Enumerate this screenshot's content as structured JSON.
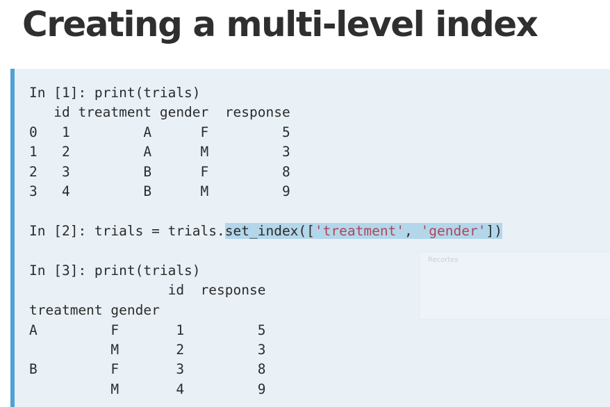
{
  "slide": {
    "title": "Creating a multi-level index"
  },
  "code": {
    "in1_prompt": "In [1]: print(trials)",
    "df1_header": "   id treatment gender  response",
    "df1_rows": [
      "0   1         A      F         5",
      "1   2         A      M         3",
      "2   3         B      F         8",
      "3   4         B      M         9"
    ],
    "in2_prefix": "In [2]: trials = trials.",
    "in2_call_start": "set_index([",
    "in2_str1": "'treatment'",
    "in2_sep": ", ",
    "in2_str2": "'gender'",
    "in2_call_end": "])",
    "in3_prompt": "In [3]: print(trials)",
    "df2_header_cols": "                 id  response",
    "df2_header_index": "treatment gender",
    "df2_rows": [
      "A         F       1         5",
      "          M       2         3",
      "B         F       3         8",
      "          M       4         9"
    ]
  },
  "overlay": {
    "label": "Recortes"
  },
  "colors": {
    "panel_bg": "#e9f1f7",
    "accent_bar": "#4fa1d6",
    "highlight": "#b3d7ea",
    "string": "#b0455b"
  }
}
